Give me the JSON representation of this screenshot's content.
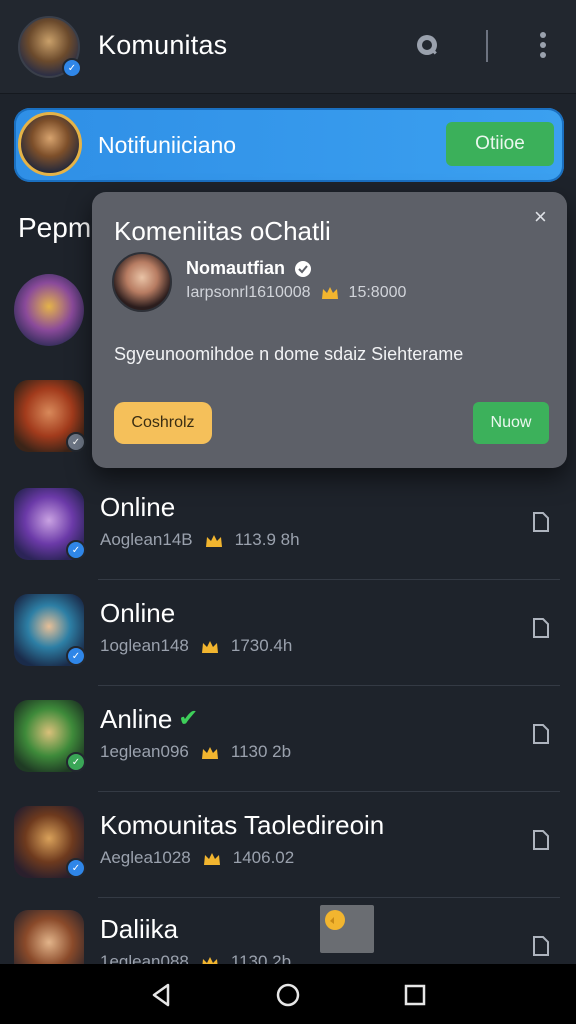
{
  "header": {
    "title": "Komunitas",
    "search_icon": "search-icon",
    "more_icon": "more-vertical-icon"
  },
  "banner": {
    "label": "Notifuniiciano",
    "action_label": "Otiioe"
  },
  "section": {
    "title": "Pepm"
  },
  "popup": {
    "title": "Komeniitas oChatli",
    "user_name": "Nomautfian",
    "meta_left": "Iarpsonrl1610008",
    "meta_right": "15:8000",
    "message": "Sgyeunoomihdoe n dome sdaiz Siehterame",
    "left_button": "Coshrolz",
    "right_button": "Nuow",
    "close_label": "×"
  },
  "list": [
    {
      "name": "Online",
      "meta_left": "Aoglean14B",
      "meta_right": "113.9 8h"
    },
    {
      "name": "Online",
      "meta_left": "1oglean148",
      "meta_right": "1730.4h"
    },
    {
      "name": "Anline",
      "meta_left": "1eglean096",
      "meta_right": "1130 2b"
    },
    {
      "name": "Komounitas Taoledireoin",
      "meta_left": "Aeglea1028",
      "meta_right": "1406.02"
    },
    {
      "name": "Daliika",
      "meta_left": "1eglean088",
      "meta_right": "1130 2b"
    }
  ],
  "colors": {
    "background": "#1e232b",
    "accent_blue": "#2f8fe6",
    "accent_green": "#3bb05a",
    "accent_yellow": "#f5c05a"
  },
  "nav": {
    "back_icon": "back-icon",
    "home_icon": "home-icon",
    "recents_icon": "recents-icon"
  }
}
